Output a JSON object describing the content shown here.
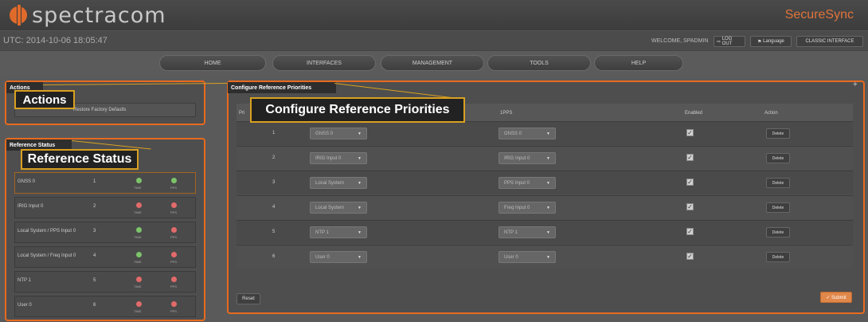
{
  "header": {
    "logo_text": "spectracom",
    "brand": "SecureSync"
  },
  "infobar": {
    "utc": "UTC: 2014-10-06 18:05:47",
    "welcome": "WELCOME, SPADMIN",
    "logout": "LOG OUT",
    "language": "Language",
    "classic": "CLASSIC INTERFACE"
  },
  "nav": {
    "tabs": [
      "HOME",
      "INTERFACES",
      "MANAGEMENT",
      "TOOLS",
      "HELP"
    ]
  },
  "actions_panel": {
    "tab": "Actions",
    "callout": "Actions",
    "restore": "Restore Factory Defaults"
  },
  "reference_status": {
    "tab": "Reference Status",
    "callout": "Reference Status",
    "time_label": "TIME",
    "pps_label": "PPS",
    "rows": [
      {
        "name": "GNSS 0",
        "num": "1",
        "time": "green",
        "pps": "green"
      },
      {
        "name": "IRIG Input 0",
        "num": "2",
        "time": "red",
        "pps": "red"
      },
      {
        "name": "Local System / PPS Input 0",
        "num": "3",
        "time": "green",
        "pps": "red"
      },
      {
        "name": "Local System / Freq Input 0",
        "num": "4",
        "time": "green",
        "pps": "red"
      },
      {
        "name": "NTP 1",
        "num": "5",
        "time": "red",
        "pps": "red"
      },
      {
        "name": "User 0",
        "num": "6",
        "time": "red",
        "pps": "red"
      }
    ]
  },
  "priorities": {
    "tab": "Configure Reference Priorities",
    "callout": "Configure Reference Priorities",
    "headers": {
      "priority": "Pri",
      "pps": "1PPS",
      "enabled": "Enabled",
      "action": "Action"
    },
    "rows": [
      {
        "num": "1",
        "time": "GNSS 0",
        "pps": "GNSS 0",
        "enabled": true
      },
      {
        "num": "2",
        "time": "IRIG Input 0",
        "pps": "IRIG Input 0",
        "enabled": true
      },
      {
        "num": "3",
        "time": "Local System",
        "pps": "PPS Input 0",
        "enabled": true
      },
      {
        "num": "4",
        "time": "Local System",
        "pps": "Freq Input 0",
        "enabled": true
      },
      {
        "num": "5",
        "time": "NTP 1",
        "pps": "NTP 1",
        "enabled": true
      },
      {
        "num": "6",
        "time": "User 0",
        "pps": "User 0",
        "enabled": true
      }
    ],
    "delete_label": "Delete",
    "reset_label": "Reset",
    "submit_label": "✓ Submit",
    "plus_icon": "+"
  },
  "colors": {
    "accent": "#e86a1e",
    "callout_border": "#d9a020",
    "brand": "#e0743a"
  }
}
